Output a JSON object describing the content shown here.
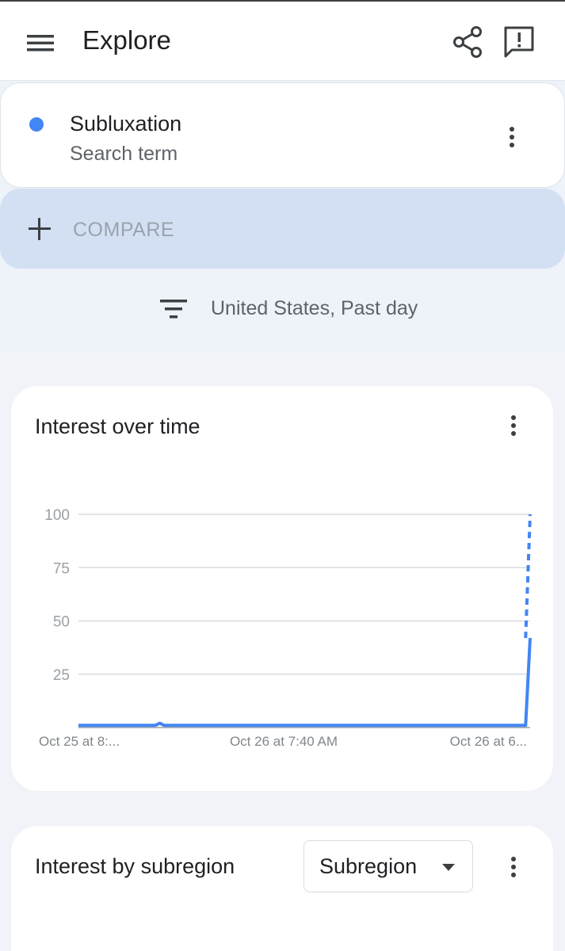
{
  "app_bar": {
    "title": "Explore",
    "menu_icon": "menu-icon",
    "share_icon": "share-icon",
    "feedback_icon": "feedback-icon"
  },
  "term": {
    "name": "Subluxation",
    "type": "Search term",
    "color": "#4285f4"
  },
  "compare": {
    "label": "COMPARE"
  },
  "filter": {
    "text": "United States, Past day",
    "icon": "filter-icon"
  },
  "interest_over_time": {
    "title": "Interest over time",
    "more_icon": "more-vert-icon"
  },
  "subregion": {
    "title": "Interest by subregion",
    "select_value": "Subregion",
    "more_icon": "more-vert-icon"
  },
  "chart_data": {
    "type": "line",
    "title": "Interest over time",
    "xlabel": "",
    "ylabel": "",
    "ylim": [
      0,
      100
    ],
    "yticks": [
      25,
      50,
      75,
      100
    ],
    "xtick_labels": [
      "Oct 25 at 8:...",
      "Oct 26 at 7:40 AM",
      "Oct 26 at 6..."
    ],
    "grid": true,
    "series": [
      {
        "color": "#4285f4",
        "x": [
          0,
          0.17,
          0.18,
          0.19,
          0.99,
          1.0
        ],
        "values": [
          1,
          1,
          2,
          1,
          1,
          42
        ],
        "partial_segment": {
          "x": [
            0.99,
            1.0
          ],
          "values": [
            42,
            100
          ]
        }
      }
    ]
  }
}
